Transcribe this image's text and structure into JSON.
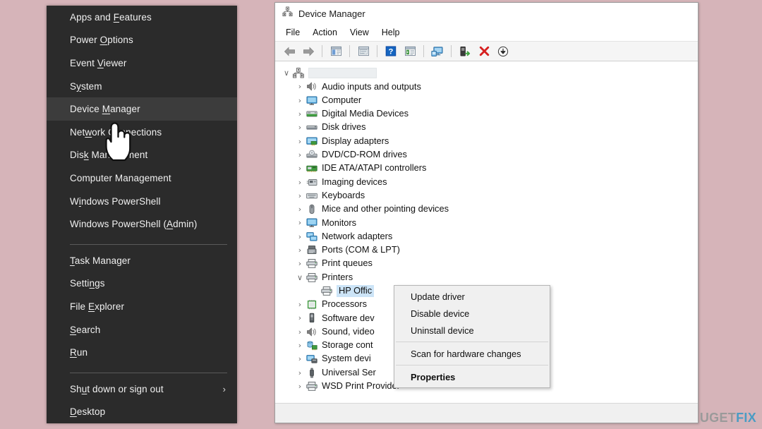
{
  "background": {
    "color": "#d6b4b9"
  },
  "winx_menu": {
    "name": "Windows Power User Menu",
    "background": "#2b2b2b",
    "selected_item": "Device Manager",
    "groups": [
      {
        "items": [
          {
            "label": "Apps and Features",
            "accel": "F",
            "selected": false
          },
          {
            "label": "Power Options",
            "accel": "O",
            "selected": false
          },
          {
            "label": "Event Viewer",
            "accel": "V",
            "selected": false
          },
          {
            "label": "System",
            "accel": "y",
            "selected": false
          },
          {
            "label": "Device Manager",
            "accel": "M",
            "selected": true
          },
          {
            "label": "Network Connections",
            "accel": "w",
            "selected": false
          },
          {
            "label": "Disk Management",
            "accel": "k",
            "selected": false
          },
          {
            "label": "Computer Management",
            "accel": "",
            "selected": false
          },
          {
            "label": "Windows PowerShell",
            "accel": "i",
            "selected": false
          },
          {
            "label": "Windows PowerShell (Admin)",
            "accel": "A",
            "selected": false
          }
        ]
      },
      {
        "items": [
          {
            "label": "Task Manager",
            "accel": "T",
            "selected": false
          },
          {
            "label": "Settings",
            "accel": "n",
            "selected": false
          },
          {
            "label": "File Explorer",
            "accel": "E",
            "selected": false
          },
          {
            "label": "Search",
            "accel": "S",
            "selected": false
          },
          {
            "label": "Run",
            "accel": "R",
            "selected": false
          }
        ]
      },
      {
        "items": [
          {
            "label": "Shut down or sign out",
            "accel": "u",
            "selected": false,
            "submenu": true
          },
          {
            "label": "Desktop",
            "accel": "D",
            "selected": false
          }
        ]
      }
    ]
  },
  "device_manager": {
    "title": "Device Manager",
    "title_icon": "device-manager-icon",
    "menubar": [
      "File",
      "Action",
      "View",
      "Help"
    ],
    "toolbar": [
      {
        "name": "back-button",
        "icon": "back-arrow-icon"
      },
      {
        "name": "forward-button",
        "icon": "forward-arrow-icon"
      },
      {
        "name": "separator-1",
        "icon": "separator"
      },
      {
        "name": "show-hide-console-tree-button",
        "icon": "console-tree-icon"
      },
      {
        "name": "separator-2",
        "icon": "separator"
      },
      {
        "name": "properties-button",
        "icon": "properties-icon"
      },
      {
        "name": "separator-3",
        "icon": "separator"
      },
      {
        "name": "help-button",
        "icon": "help-question-icon"
      },
      {
        "name": "show-hide-action-pane-button",
        "icon": "action-pane-icon"
      },
      {
        "name": "separator-4",
        "icon": "separator"
      },
      {
        "name": "scan-hardware-changes-button",
        "icon": "scan-monitor-icon"
      },
      {
        "name": "separator-5",
        "icon": "separator"
      },
      {
        "name": "update-driver-button",
        "icon": "update-driver-icon"
      },
      {
        "name": "uninstall-device-button",
        "icon": "red-x-icon"
      },
      {
        "name": "disable-device-button",
        "icon": "down-arrow-circle-icon"
      }
    ],
    "tree": {
      "root": {
        "label": "",
        "redacted": true,
        "icon": "computer-root-icon",
        "expanded": true
      },
      "nodes": [
        {
          "label": "Audio inputs and outputs",
          "icon": "speaker-icon",
          "expanded": false,
          "level": 1
        },
        {
          "label": "Computer",
          "icon": "monitor-icon",
          "expanded": false,
          "level": 1
        },
        {
          "label": "Digital Media Devices",
          "icon": "media-device-icon",
          "expanded": false,
          "level": 1
        },
        {
          "label": "Disk drives",
          "icon": "disk-drive-icon",
          "expanded": false,
          "level": 1
        },
        {
          "label": "Display adapters",
          "icon": "display-adapter-icon",
          "expanded": false,
          "level": 1
        },
        {
          "label": "DVD/CD-ROM drives",
          "icon": "dvd-drive-icon",
          "expanded": false,
          "level": 1
        },
        {
          "label": "IDE ATA/ATAPI controllers",
          "icon": "ide-controller-icon",
          "expanded": false,
          "level": 1
        },
        {
          "label": "Imaging devices",
          "icon": "imaging-device-icon",
          "expanded": false,
          "level": 1
        },
        {
          "label": "Keyboards",
          "icon": "keyboard-icon",
          "expanded": false,
          "level": 1
        },
        {
          "label": "Mice and other pointing devices",
          "icon": "mouse-icon",
          "expanded": false,
          "level": 1
        },
        {
          "label": "Monitors",
          "icon": "monitor-icon",
          "expanded": false,
          "level": 1
        },
        {
          "label": "Network adapters",
          "icon": "network-adapter-icon",
          "expanded": false,
          "level": 1
        },
        {
          "label": "Ports (COM & LPT)",
          "icon": "port-icon",
          "expanded": false,
          "level": 1
        },
        {
          "label": "Print queues",
          "icon": "printer-icon",
          "expanded": false,
          "level": 1
        },
        {
          "label": "Printers",
          "icon": "printer-icon",
          "expanded": true,
          "level": 1
        },
        {
          "label": "HP Offic",
          "icon": "printer-icon",
          "expanded": false,
          "level": 2,
          "selected": true,
          "truncated": true
        },
        {
          "label": "Processors",
          "icon": "processor-icon",
          "expanded": false,
          "level": 1
        },
        {
          "label": "Software dev",
          "icon": "software-device-icon",
          "expanded": false,
          "level": 1,
          "truncated": true
        },
        {
          "label": "Sound, video",
          "icon": "speaker-icon",
          "expanded": false,
          "level": 1,
          "truncated": true
        },
        {
          "label": "Storage cont",
          "icon": "storage-controller-icon",
          "expanded": false,
          "level": 1,
          "truncated": true
        },
        {
          "label": "System devi",
          "icon": "system-device-icon",
          "expanded": false,
          "level": 1,
          "truncated": true
        },
        {
          "label": "Universal Ser",
          "icon": "usb-icon",
          "expanded": false,
          "level": 1,
          "truncated": true
        },
        {
          "label": "WSD Print Provider",
          "icon": "printer-icon",
          "expanded": false,
          "level": 1
        }
      ]
    }
  },
  "context_menu": {
    "name": "device-context-menu",
    "groups": [
      {
        "items": [
          {
            "label": "Update driver",
            "bold": false
          },
          {
            "label": "Disable device",
            "bold": false
          },
          {
            "label": "Uninstall device",
            "bold": false
          }
        ]
      },
      {
        "items": [
          {
            "label": "Scan for hardware changes",
            "bold": false
          }
        ]
      },
      {
        "items": [
          {
            "label": "Properties",
            "bold": true
          }
        ]
      }
    ]
  },
  "watermark": {
    "part1": "UG",
    "part2": "E",
    "part3": "T",
    "part4": "FIX",
    "full": "UGETFIX"
  }
}
